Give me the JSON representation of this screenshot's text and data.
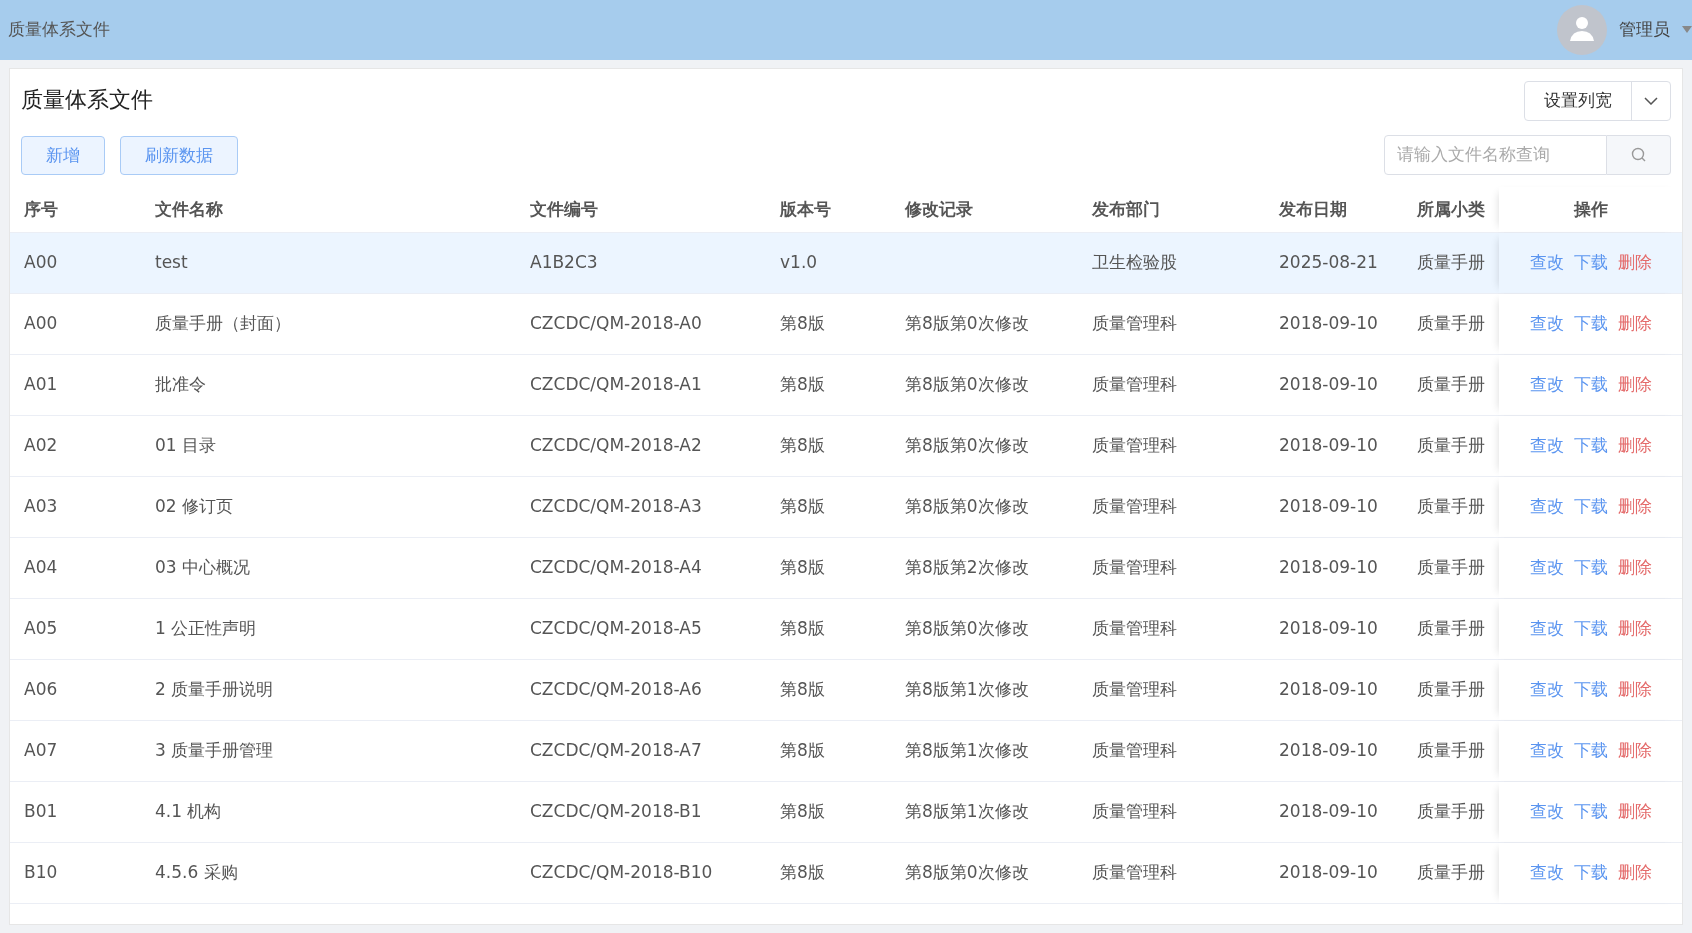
{
  "header": {
    "title": "质量体系文件",
    "user": "管理员"
  },
  "page": {
    "title": "质量体系文件",
    "buttons": [
      "新增",
      "刷新数据"
    ],
    "column_width_button": "设置列宽",
    "search": {
      "placeholder": "请输入文件名称查询"
    }
  },
  "table": {
    "columns": [
      "序号",
      "文件名称",
      "文件编号",
      "版本号",
      "修改记录",
      "发布部门",
      "发布日期",
      "所属小类",
      "操作"
    ],
    "rows": [
      {
        "selected": true,
        "cells": [
          "A00",
          "test",
          "A1B2C3",
          "v1.0",
          "",
          "卫生检验股",
          "2025-08-21",
          "质量手册"
        ],
        "actions": [
          {
            "label": "查改",
            "kind": "link"
          },
          {
            "label": "下载",
            "kind": "link"
          },
          {
            "label": "删除",
            "kind": "danger"
          }
        ]
      },
      {
        "selected": false,
        "cells": [
          "A00",
          "质量手册（封面）",
          "CZCDC/QM-2018-A0",
          "第8版",
          "第8版第0次修改",
          "质量管理科",
          "2018-09-10",
          "质量手册"
        ],
        "actions": [
          {
            "label": "查改",
            "kind": "link"
          },
          {
            "label": "下载",
            "kind": "link"
          },
          {
            "label": "删除",
            "kind": "danger"
          }
        ]
      },
      {
        "selected": false,
        "cells": [
          "A01",
          "批准令",
          "CZCDC/QM-2018-A1",
          "第8版",
          "第8版第0次修改",
          "质量管理科",
          "2018-09-10",
          "质量手册"
        ],
        "actions": [
          {
            "label": "查改",
            "kind": "link"
          },
          {
            "label": "下载",
            "kind": "link"
          },
          {
            "label": "删除",
            "kind": "danger"
          }
        ]
      },
      {
        "selected": false,
        "cells": [
          "A02",
          "01 目录",
          "CZCDC/QM-2018-A2",
          "第8版",
          "第8版第0次修改",
          "质量管理科",
          "2018-09-10",
          "质量手册"
        ],
        "actions": [
          {
            "label": "查改",
            "kind": "link"
          },
          {
            "label": "下载",
            "kind": "link"
          },
          {
            "label": "删除",
            "kind": "danger"
          }
        ]
      },
      {
        "selected": false,
        "cells": [
          "A03",
          "02 修订页",
          "CZCDC/QM-2018-A3",
          "第8版",
          "第8版第0次修改",
          "质量管理科",
          "2018-09-10",
          "质量手册"
        ],
        "actions": [
          {
            "label": "查改",
            "kind": "link"
          },
          {
            "label": "下载",
            "kind": "link"
          },
          {
            "label": "删除",
            "kind": "danger"
          }
        ]
      },
      {
        "selected": false,
        "cells": [
          "A04",
          "03 中心概况",
          "CZCDC/QM-2018-A4",
          "第8版",
          "第8版第2次修改",
          "质量管理科",
          "2018-09-10",
          "质量手册"
        ],
        "actions": [
          {
            "label": "查改",
            "kind": "link"
          },
          {
            "label": "下载",
            "kind": "link"
          },
          {
            "label": "删除",
            "kind": "danger"
          }
        ]
      },
      {
        "selected": false,
        "cells": [
          "A05",
          "1 公正性声明",
          "CZCDC/QM-2018-A5",
          "第8版",
          "第8版第0次修改",
          "质量管理科",
          "2018-09-10",
          "质量手册"
        ],
        "actions": [
          {
            "label": "查改",
            "kind": "link"
          },
          {
            "label": "下载",
            "kind": "link"
          },
          {
            "label": "删除",
            "kind": "danger"
          }
        ]
      },
      {
        "selected": false,
        "cells": [
          "A06",
          "2 质量手册说明",
          "CZCDC/QM-2018-A6",
          "第8版",
          "第8版第1次修改",
          "质量管理科",
          "2018-09-10",
          "质量手册"
        ],
        "actions": [
          {
            "label": "查改",
            "kind": "link"
          },
          {
            "label": "下载",
            "kind": "link"
          },
          {
            "label": "删除",
            "kind": "danger"
          }
        ]
      },
      {
        "selected": false,
        "cells": [
          "A07",
          "3 质量手册管理",
          "CZCDC/QM-2018-A7",
          "第8版",
          "第8版第1次修改",
          "质量管理科",
          "2018-09-10",
          "质量手册"
        ],
        "actions": [
          {
            "label": "查改",
            "kind": "link"
          },
          {
            "label": "下载",
            "kind": "link"
          },
          {
            "label": "删除",
            "kind": "danger"
          }
        ]
      },
      {
        "selected": false,
        "cells": [
          "B01",
          "4.1 机构",
          "CZCDC/QM-2018-B1",
          "第8版",
          "第8版第1次修改",
          "质量管理科",
          "2018-09-10",
          "质量手册"
        ],
        "actions": [
          {
            "label": "查改",
            "kind": "link"
          },
          {
            "label": "下载",
            "kind": "link"
          },
          {
            "label": "删除",
            "kind": "danger"
          }
        ]
      },
      {
        "selected": false,
        "cells": [
          "B10",
          "4.5.6 采购",
          "CZCDC/QM-2018-B10",
          "第8版",
          "第8版第0次修改",
          "质量管理科",
          "2018-09-10",
          "质量手册"
        ],
        "actions": [
          {
            "label": "查改",
            "kind": "link"
          },
          {
            "label": "下载",
            "kind": "link"
          },
          {
            "label": "删除",
            "kind": "danger"
          }
        ]
      }
    ]
  }
}
